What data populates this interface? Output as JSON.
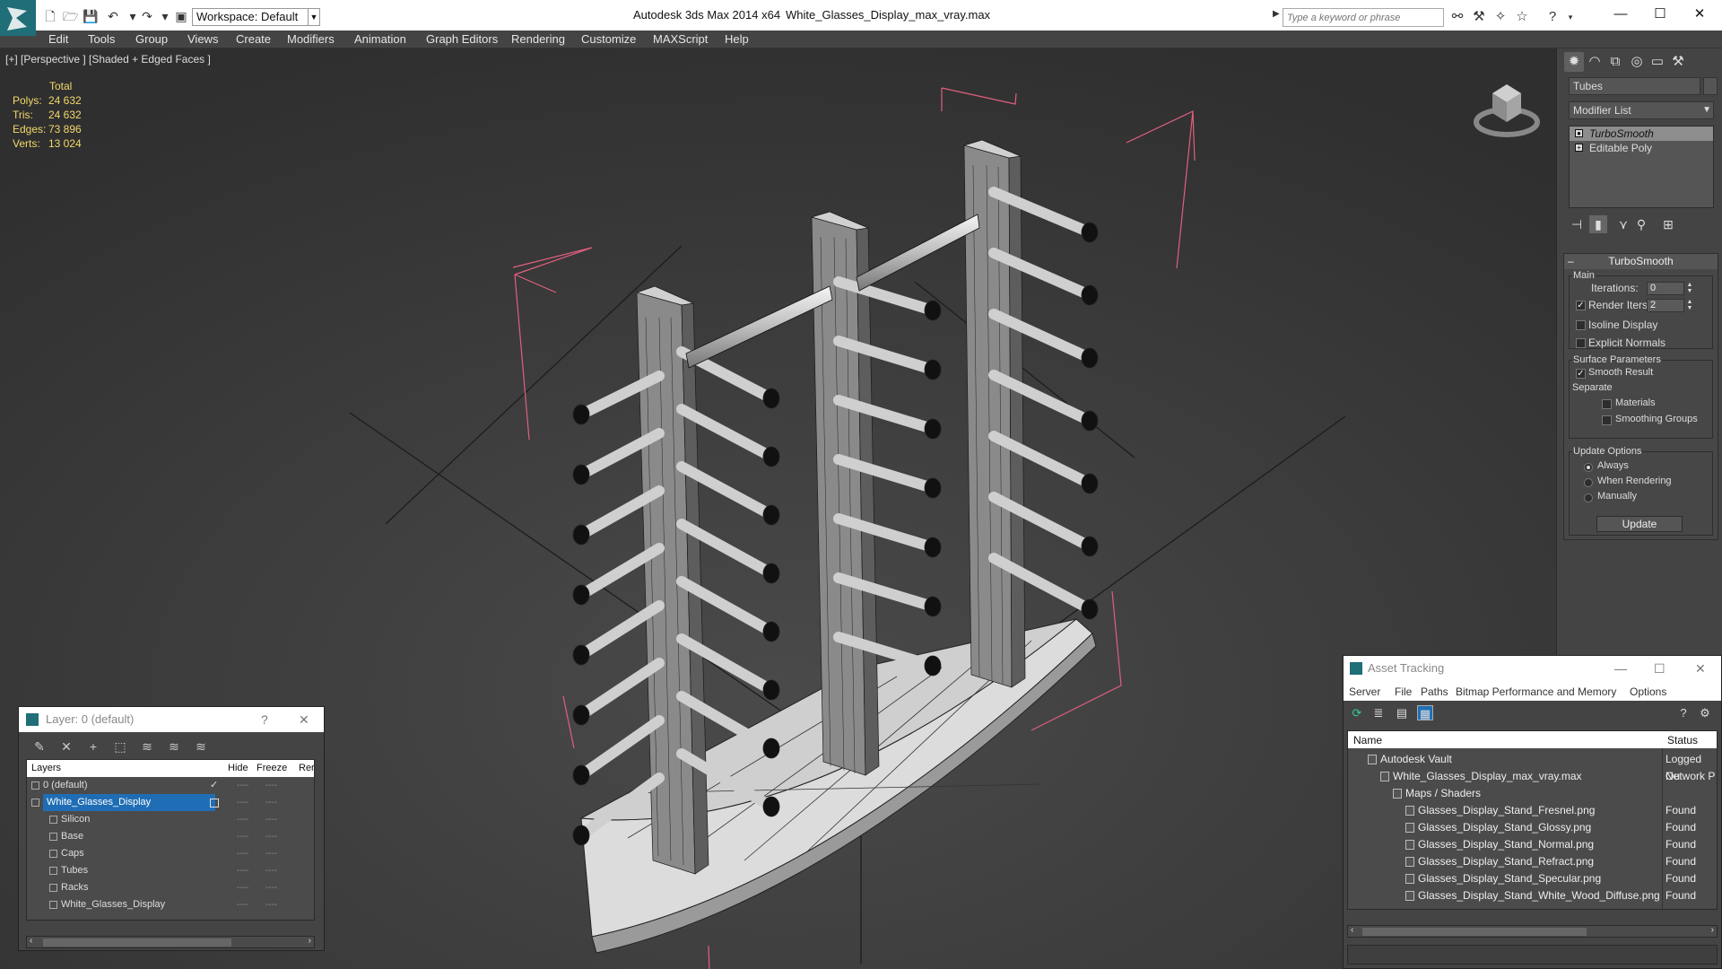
{
  "titlebar": {
    "app_title": "Autodesk 3ds Max  2014 x64",
    "file_title": "White_Glasses_Display_max_vray.max",
    "workspace": "Workspace: Default",
    "search_placeholder": "Type a keyword or phrase",
    "minimize": "—",
    "maximize": "☐",
    "close": "✕"
  },
  "menu": [
    "Edit",
    "Tools",
    "Group",
    "Views",
    "Create",
    "Modifiers",
    "Animation",
    "Graph Editors",
    "Rendering",
    "Customize",
    "MAXScript",
    "Help"
  ],
  "viewport": {
    "label": "[+] [Perspective ] [Shaded + Edged Faces ]",
    "stats": {
      "header": "Total",
      "rows": [
        {
          "label": "Polys:",
          "value": "24 632"
        },
        {
          "label": "Tris:",
          "value": "24 632"
        },
        {
          "label": "Edges:",
          "value": "73 896"
        },
        {
          "label": "Verts:",
          "value": "13 024"
        }
      ]
    }
  },
  "command_panel": {
    "object_name": "Tubes",
    "modifier_list": "Modifier List",
    "stack": [
      "TurboSmooth",
      "Editable Poly"
    ],
    "rollout_title": "TurboSmooth",
    "main_label": "Main",
    "iterations_label": "Iterations:",
    "iterations_value": "0",
    "render_iters_label": "Render Iters:",
    "render_iters_value": "2",
    "render_iters_checked": true,
    "isoline_label": "Isoline Display",
    "explicit_normals_label": "Explicit Normals",
    "surface_params_label": "Surface Parameters",
    "smooth_result_label": "Smooth Result",
    "smooth_result_checked": true,
    "separate_label": "Separate",
    "materials_label": "Materials",
    "smoothing_groups_label": "Smoothing Groups",
    "update_options_label": "Update Options",
    "update_options": [
      "Always",
      "When Rendering",
      "Manually"
    ],
    "update_selected": "Always",
    "update_button": "Update"
  },
  "layer_window": {
    "title": "Layer: 0 (default)",
    "help": "?",
    "close": "✕",
    "columns": [
      "Layers",
      "Hide",
      "Freeze",
      "Rer"
    ],
    "rows": [
      {
        "name": "0 (default)",
        "indent": 0,
        "current": "✓"
      },
      {
        "name": "White_Glasses_Display",
        "indent": 0,
        "current": ""
      },
      {
        "name": "Silicon",
        "indent": 1
      },
      {
        "name": "Base",
        "indent": 1
      },
      {
        "name": "Caps",
        "indent": 1
      },
      {
        "name": "Tubes",
        "indent": 1
      },
      {
        "name": "Racks",
        "indent": 1
      },
      {
        "name": "White_Glasses_Display",
        "indent": 1
      }
    ],
    "dash": "----"
  },
  "asset_window": {
    "title": "Asset Tracking",
    "menu": [
      "Server",
      "File",
      "Paths",
      "Bitmap Performance and Memory",
      "Options"
    ],
    "columns": [
      "Name",
      "Status"
    ],
    "rows": [
      {
        "name": "Autodesk Vault",
        "indent": 1,
        "status": "Logged Ou"
      },
      {
        "name": "White_Glasses_Display_max_vray.max",
        "indent": 2,
        "status": "Network P"
      },
      {
        "name": "Maps / Shaders",
        "indent": 3,
        "status": ""
      },
      {
        "name": "Glasses_Display_Stand_Fresnel.png",
        "indent": 4,
        "status": "Found"
      },
      {
        "name": "Glasses_Display_Stand_Glossy.png",
        "indent": 4,
        "status": "Found"
      },
      {
        "name": "Glasses_Display_Stand_Normal.png",
        "indent": 4,
        "status": "Found"
      },
      {
        "name": "Glasses_Display_Stand_Refract.png",
        "indent": 4,
        "status": "Found"
      },
      {
        "name": "Glasses_Display_Stand_Specular.png",
        "indent": 4,
        "status": "Found"
      },
      {
        "name": "Glasses_Display_Stand_White_Wood_Diffuse.png",
        "indent": 4,
        "status": "Found"
      }
    ]
  },
  "colors": {
    "selection": "#1f6eb5",
    "stats_text": "#f2d86a",
    "bbox": "#e0607e",
    "viewport_bg": "#3b3b3b"
  }
}
